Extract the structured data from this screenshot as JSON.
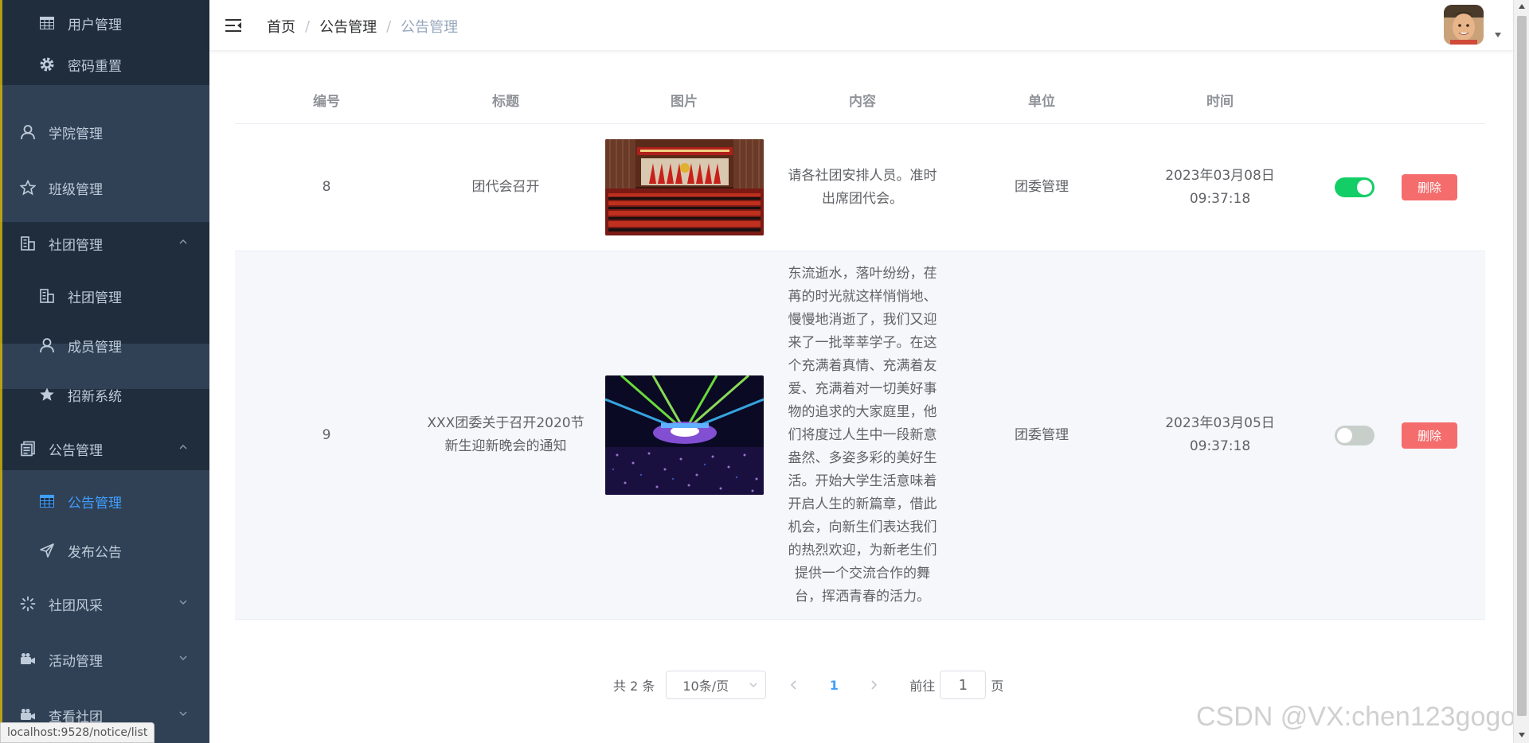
{
  "sidebar": {
    "items": [
      {
        "label": "用户管理",
        "icon": "table-icon"
      },
      {
        "label": "密码重置",
        "icon": "gear-icon"
      },
      {
        "label": "学院管理",
        "icon": "user-icon"
      },
      {
        "label": "班级管理",
        "icon": "star-outline-icon"
      },
      {
        "label": "社团管理",
        "icon": "building-icon",
        "expanded": true
      },
      {
        "label": "社团管理",
        "icon": "building-icon"
      },
      {
        "label": "成员管理",
        "icon": "user-icon"
      },
      {
        "label": "招新系统",
        "icon": "star-filled-icon"
      },
      {
        "label": "公告管理",
        "icon": "document-icon",
        "expanded": true
      },
      {
        "label": "公告管理",
        "icon": "table-icon",
        "active": true
      },
      {
        "label": "发布公告",
        "icon": "send-icon"
      },
      {
        "label": "社团风采",
        "icon": "loading-icon",
        "expanded": false
      },
      {
        "label": "活动管理",
        "icon": "camera-icon",
        "expanded": false
      },
      {
        "label": "查看社团",
        "icon": "camera-icon",
        "expanded": false
      }
    ],
    "status_url": "localhost:9528/notice/list",
    "colors": {
      "bg": "#304156",
      "submenu_bg": "#1f2d3d",
      "text": "#bfcbd9",
      "active": "#409eff"
    }
  },
  "navbar": {
    "breadcrumb": [
      "首页",
      "公告管理",
      "公告管理"
    ],
    "separator": "/"
  },
  "table": {
    "headers": [
      "编号",
      "标题",
      "图片",
      "内容",
      "单位",
      "时间"
    ],
    "rows": [
      {
        "id": "8",
        "title": "团代会召开",
        "image": "conference-hall-photo",
        "content": "请各社团安排人员。准时出席团代会。",
        "unit": "团委管理",
        "time": "2023年03月08日 09:37:18",
        "switch_on": true,
        "delete_label": "删除"
      },
      {
        "id": "9",
        "title": "XXX团委关于召开2020节新生迎新晚会的通知",
        "image": "stage-concert-photo",
        "content": "东流逝水，落叶纷纷，荏苒的时光就这样悄悄地、慢慢地消逝了，我们又迎来了一批莘莘学子。在这个充满着真情、充满着友爱、充满着对一切美好事物的追求的大家庭里，他们将度过人生中一段新意盎然、多姿多彩的美好生活。开始大学生活意味着开启人生的新篇章，借此机会，向新生们表达我们的热烈欢迎，为新老生们提供一个交流合作的舞台，挥洒青春的活力。",
        "unit": "团委管理",
        "time": "2023年03月05日 09:37:18",
        "switch_on": false,
        "delete_label": "删除"
      }
    ]
  },
  "pagination": {
    "total": "共 2 条",
    "page_size": "10条/页",
    "current_page": "1",
    "jump_label": "前往",
    "jump_value": "1",
    "page_unit": "页"
  },
  "watermark": "CSDN @VX:chen123gogo",
  "colors": {
    "accent": "#409eff",
    "switch_on": "#13ce66",
    "danger": "#f56c6c"
  }
}
